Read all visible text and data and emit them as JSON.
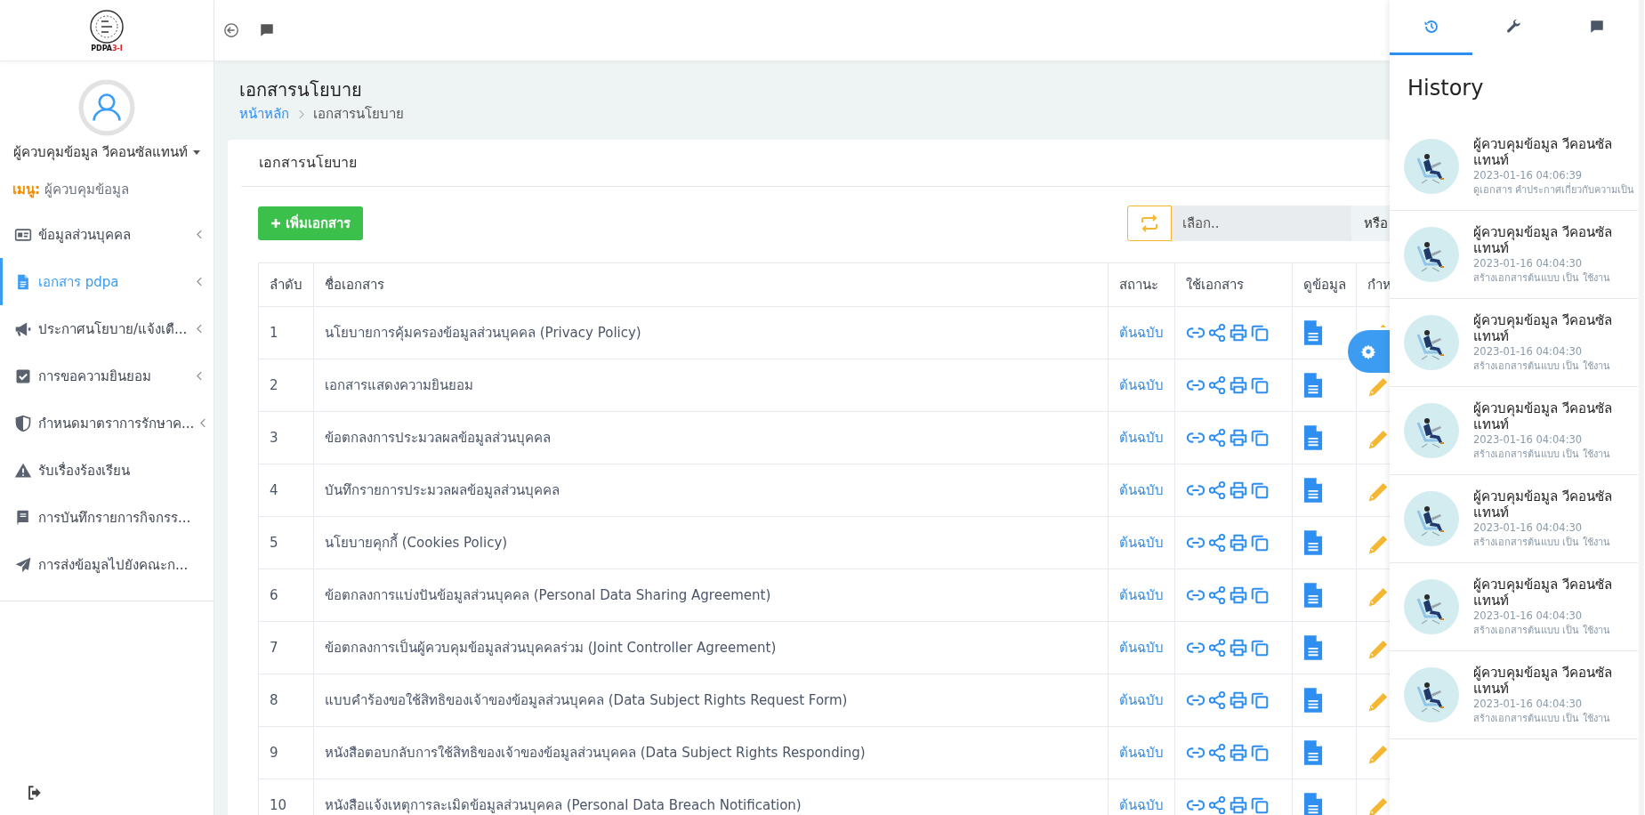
{
  "logo": {
    "text": "PDPA",
    "suffix": "3-I"
  },
  "user": {
    "name": "ผู้ควบคุมข้อมูล วีคอนซัลแทนท์",
    "menu_label": "เมนู:",
    "role": "ผู้ควบคุมข้อมูล"
  },
  "sidebar": {
    "items": [
      {
        "label": "ข้อมูลส่วนบุคคล",
        "selected": false,
        "submenu": true
      },
      {
        "label": "เอกสาร pdpa",
        "selected": true,
        "submenu": true
      },
      {
        "label": "ประกาศนโยบาย/แจ้งเตื...",
        "selected": false,
        "submenu": true
      },
      {
        "label": "การขอความยินยอม",
        "selected": false,
        "submenu": true
      },
      {
        "label": "กำหนดมาตราการรักษาค...",
        "selected": false,
        "submenu": true
      },
      {
        "label": "รับเรื่องร้องเรียน",
        "selected": false,
        "submenu": false
      },
      {
        "label": "การบันทึกรายการกิจกรร...",
        "selected": false,
        "submenu": false
      },
      {
        "label": "การส่งข้อมูลไปยังคณะก...",
        "selected": false,
        "submenu": false
      }
    ]
  },
  "page": {
    "title": "เอกสารนโยบาย",
    "breadcrumb": [
      {
        "label": "หน้าหลัก",
        "link": true
      },
      {
        "label": "เอกสารนโยบาย",
        "link": false
      }
    ]
  },
  "card": {
    "title": "เอกสารนโยบาย",
    "add_button": "เพิ่มเอกสาร",
    "select": {
      "placeholder": "เลือก..",
      "addon": "หรือ"
    }
  },
  "table": {
    "columns": [
      "ลำดับ",
      "ชื่อเอกสาร",
      "สถานะ",
      "ใช้เอกสาร",
      "ดูข้อมูล",
      "กำห"
    ],
    "rows": [
      {
        "no": "1",
        "name": "นโยบายการคุ้มครองข้อมูลส่วนบุคคล (Privacy Policy)",
        "status": "ต้นฉบับ"
      },
      {
        "no": "2",
        "name": "เอกสารแสดงความยินยอม",
        "status": "ต้นฉบับ"
      },
      {
        "no": "3",
        "name": "ข้อตกลงการประมวลผลข้อมูลส่วนบุคคล",
        "status": "ต้นฉบับ"
      },
      {
        "no": "4",
        "name": "บันทึกรายการประมวลผลข้อมูลส่วนบุคคล",
        "status": "ต้นฉบับ"
      },
      {
        "no": "5",
        "name": "นโยบายคุกกี้ (Cookies Policy)",
        "status": "ต้นฉบับ"
      },
      {
        "no": "6",
        "name": "ข้อตกลงการแบ่งปันข้อมูลส่วนบุคคล (Personal Data Sharing Agreement)",
        "status": "ต้นฉบับ"
      },
      {
        "no": "7",
        "name": "ข้อตกลงการเป็นผู้ควบคุมข้อมูลส่วนบุคคลร่วม (Joint Controller Agreement)",
        "status": "ต้นฉบับ"
      },
      {
        "no": "8",
        "name": "แบบคำร้องขอใช้สิทธิของเจ้าของข้อมูลส่วนบุคคล (Data Subject Rights Request Form)",
        "status": "ต้นฉบับ"
      },
      {
        "no": "9",
        "name": "หนังสือตอบกลับการใช้สิทธิของเจ้าของข้อมูลส่วนบุคคล (Data Subject Rights Responding)",
        "status": "ต้นฉบับ"
      },
      {
        "no": "10",
        "name": "หนังสือแจ้งเหตุการละเมิดข้อมูลส่วนบุคคล (Personal Data Breach Notification)",
        "status": "ต้นฉบับ"
      }
    ]
  },
  "history": {
    "tabs": [
      {
        "selected": true
      },
      {
        "selected": false
      },
      {
        "selected": false
      }
    ],
    "title": "History",
    "items": [
      {
        "name": "ผู้ควบคุมข้อมูล วีคอนซัลแทนท์",
        "time": "2023-01-16 04:06:39",
        "action": "ดูเอกสาร คำประกาศเกี่ยวกับความเป็น"
      },
      {
        "name": "ผู้ควบคุมข้อมูล วีคอนซัลแทนท์",
        "time": "2023-01-16 04:04:30",
        "action": "สร้างเอกสารต้นแบบ เป็น ใช้งาน"
      },
      {
        "name": "ผู้ควบคุมข้อมูล วีคอนซัลแทนท์",
        "time": "2023-01-16 04:04:30",
        "action": "สร้างเอกสารต้นแบบ เป็น ใช้งาน"
      },
      {
        "name": "ผู้ควบคุมข้อมูล วีคอนซัลแทนท์",
        "time": "2023-01-16 04:04:30",
        "action": "สร้างเอกสารต้นแบบ เป็น ใช้งาน"
      },
      {
        "name": "ผู้ควบคุมข้อมูล วีคอนซัลแทนท์",
        "time": "2023-01-16 04:04:30",
        "action": "สร้างเอกสารต้นแบบ เป็น ใช้งาน"
      },
      {
        "name": "ผู้ควบคุมข้อมูล วีคอนซัลแทนท์",
        "time": "2023-01-16 04:04:30",
        "action": "สร้างเอกสารต้นแบบ เป็น ใช้งาน"
      },
      {
        "name": "ผู้ควบคุมข้อมูล วีคอนซัลแทนท์",
        "time": "2023-01-16 04:04:30",
        "action": "สร้างเอกสารต้นแบบ เป็น ใช้งาน"
      }
    ]
  }
}
